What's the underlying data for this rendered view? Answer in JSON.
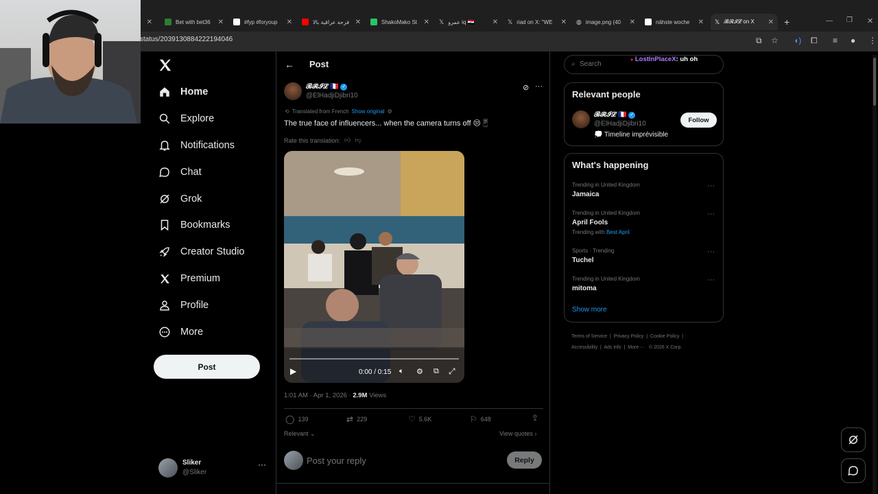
{
  "browser": {
    "tabs": [
      {
        "label": "Bet with bet36",
        "color": "#2e7d32"
      },
      {
        "label": "#fyp #foryoup",
        "color": "#ffffff"
      },
      {
        "label": "فرحة عراقية بالا",
        "color": "#ff0000"
      },
      {
        "label": "ShakoMako St",
        "color": "#29c36a"
      },
      {
        "label": "عمرو iq 🇮🇶",
        "color": "#ffffff"
      },
      {
        "label": "riad on X: \"WE",
        "color": "#ffffff"
      },
      {
        "label": "image.png (40",
        "color": "#bbbbbb"
      },
      {
        "label": "nähste woche",
        "color": "#ffffff"
      },
      {
        "label": "𝓑𝓡𝓘𝓛 on X",
        "color": "#ffffff"
      }
    ],
    "url": "status/2039130884222194046"
  },
  "sidebar": {
    "items": [
      {
        "label": "Home",
        "icon": "home-icon"
      },
      {
        "label": "Explore",
        "icon": "search-icon"
      },
      {
        "label": "Notifications",
        "icon": "bell-icon"
      },
      {
        "label": "Chat",
        "icon": "chat-icon"
      },
      {
        "label": "Grok",
        "icon": "grok-icon"
      },
      {
        "label": "Bookmarks",
        "icon": "bookmark-icon"
      },
      {
        "label": "Creator Studio",
        "icon": "rocket-icon"
      },
      {
        "label": "Premium",
        "icon": "x-logo-icon"
      },
      {
        "label": "Profile",
        "icon": "person-icon"
      },
      {
        "label": "More",
        "icon": "more-circle-icon"
      }
    ],
    "post_label": "Post",
    "account": {
      "name": "Sliker",
      "handle": "@Sliker"
    }
  },
  "post": {
    "header_title": "Post",
    "author_name": "𝓑𝓡𝓘𝓛 🇨🇵",
    "author_handle": "@ElHadjiDjibri10",
    "translated_from": "Translated from French",
    "show_original": "Show original",
    "text": "The true face of influencers... when the camera turns off 😒📱",
    "rate_translation": "Rate this translation:",
    "video_time": "0:00 / 0:15",
    "time": "1:01 AM · Apr 1, 2026 · ",
    "views_count": "2.9M",
    "views_label": " Views",
    "replies": "139",
    "reposts": "229",
    "likes": "5.6K",
    "bookmarks": "648",
    "relevant": "Relevant",
    "view_quotes": "View quotes",
    "reply_placeholder": "Post your reply",
    "reply_button": "Reply"
  },
  "right": {
    "search_placeholder": "Search",
    "overlay_user": "LostInPlaceX",
    "overlay_text": ": uh oh",
    "relevant_title": "Relevant people",
    "person_name": "𝓑𝓡𝓘𝓛 🇨🇵",
    "person_handle": "@ElHadjiDjibri10",
    "person_bio": "💭 Timeline imprévisible",
    "follow": "Follow",
    "happening_title": "What's happening",
    "trends": [
      {
        "sub": "Trending in United Kingdom",
        "title": "Jamaica",
        "extra": ""
      },
      {
        "sub": "Trending in United Kingdom",
        "title": "April Fools",
        "extra": "Trending with",
        "extra_link": "Best April"
      },
      {
        "sub": "Sports · Trending",
        "title": "Tuchel",
        "extra": ""
      },
      {
        "sub": "Trending in United Kingdom",
        "title": "mitoma",
        "extra": ""
      }
    ],
    "show_more": "Show more",
    "footer": [
      "Terms of Service",
      "Privacy Policy",
      "Cookie Policy",
      "Accessibility",
      "Ads info",
      "More ···",
      "© 2026 X Corp."
    ]
  }
}
